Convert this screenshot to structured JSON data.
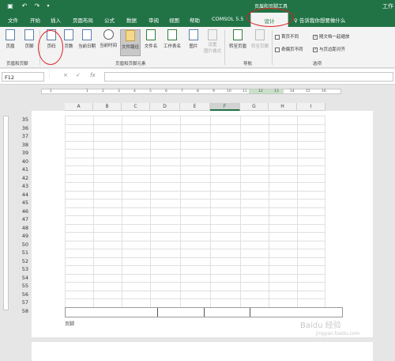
{
  "titlebar": {
    "context_title": "页眉和页脚工具",
    "app_title": "工作",
    "qat_save_icon": "save-icon",
    "qat_undo_icon": "undo-icon",
    "qat_redo_icon": "redo-icon"
  },
  "tabs": [
    "文件",
    "开始",
    "插入",
    "页面布局",
    "公式",
    "数据",
    "审阅",
    "视图",
    "帮助",
    "COMSOL 5.5",
    "设计"
  ],
  "active_tab": "设计",
  "tell_me": "告诉我你想要做什么",
  "ribbon": {
    "header_btn": "页眉",
    "footer_btn": "页脚",
    "page_number_btn": "页码",
    "page_count_btn": "页数",
    "current_date_btn": "当前日期",
    "current_time_btn": "当前时间",
    "file_path_btn": "文件路径",
    "file_name_btn": "文件名",
    "sheet_name_btn": "工作表名",
    "picture_btn": "图片",
    "format_picture_btn_line1": "设置",
    "format_picture_btn_line2": "图片格式",
    "goto_header_btn": "转至页眉",
    "goto_footer_btn": "转至页脚",
    "group_header_footer": "页眉和页脚",
    "group_elements": "页眉和页脚元素",
    "group_nav": "导航",
    "group_options": "选项",
    "opt_diff_first": "首页不同",
    "opt_diff_odd_even": "奇偶页不同",
    "opt_scale_with_doc": "随文档一起缩放",
    "opt_align_margins": "与页边距对齐",
    "checks": {
      "diff_first": false,
      "diff_odd_even": false,
      "scale_with_doc": true,
      "align_margins": true
    }
  },
  "formula_bar": {
    "name_box": "F12",
    "cancel_icon": "×",
    "enter_icon": "✓",
    "fx_label": "fx",
    "formula": ""
  },
  "ruler_ticks": [
    "1",
    "1",
    "2",
    "3",
    "4",
    "5",
    "6",
    "7",
    "8",
    "9",
    "10",
    "11",
    "12",
    "13",
    "14",
    "15",
    "16",
    "17",
    "18",
    "19"
  ],
  "columns": [
    "A",
    "B",
    "C",
    "D",
    "E",
    "F",
    "G",
    "H",
    "I"
  ],
  "selected_column": "F",
  "rows": [
    "35",
    "36",
    "37",
    "38",
    "39",
    "40",
    "41",
    "42",
    "43",
    "44",
    "45",
    "46",
    "47",
    "48",
    "49",
    "50",
    "51",
    "52",
    "53",
    "54",
    "55",
    "56",
    "57",
    "58"
  ],
  "footer_label": "页脚",
  "watermark": "Baidu 经验",
  "watermark_url": "jingyan.baidu.com"
}
